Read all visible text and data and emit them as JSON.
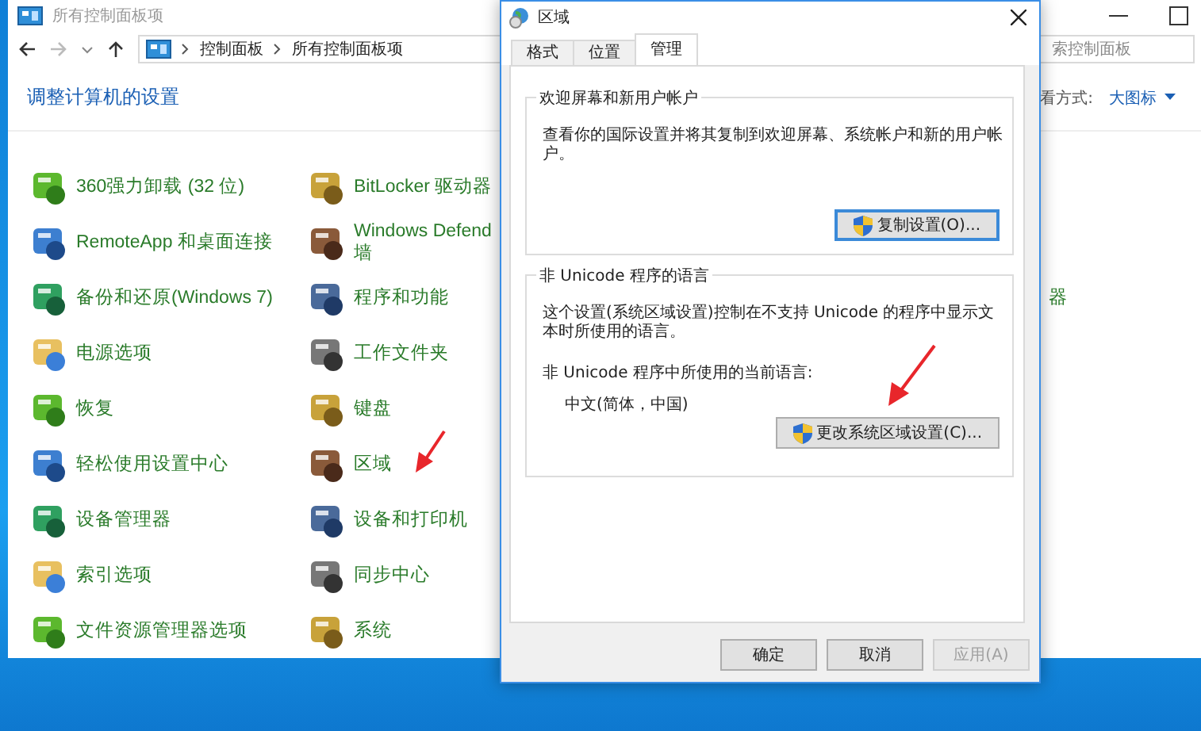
{
  "control_panel": {
    "title": "所有控制面板项",
    "breadcrumb": [
      "控制面板",
      "所有控制面板项"
    ],
    "search": {
      "placeholder": "索控制面板"
    },
    "heading": "调整计算机的设置",
    "view_label": "看方式:",
    "view_value": "大图标",
    "rows": [
      [
        {
          "label": "360强力卸载 (32 位)"
        },
        {
          "label": "BitLocker 驱动器"
        }
      ],
      [
        {
          "label": "RemoteApp 和桌面连接"
        },
        {
          "label": "Windows Defend",
          "label_2": "墙"
        }
      ],
      [
        {
          "label": "备份和还原(Windows 7)"
        },
        {
          "label": "程序和功能"
        },
        {
          "label": "器"
        }
      ],
      [
        {
          "label": "电源选项"
        },
        {
          "label": "工作文件夹"
        }
      ],
      [
        {
          "label": "恢复"
        },
        {
          "label": "键盘"
        }
      ],
      [
        {
          "label": "轻松使用设置中心"
        },
        {
          "label": "区域"
        }
      ],
      [
        {
          "label": "设备管理器"
        },
        {
          "label": "设备和打印机"
        }
      ],
      [
        {
          "label": "索引选项"
        },
        {
          "label": "同步中心"
        }
      ],
      [
        {
          "label": "文件资源管理器选项"
        },
        {
          "label": "系统"
        }
      ]
    ]
  },
  "dialog": {
    "title": "区域",
    "tabs": [
      {
        "label": "格式",
        "selected": false
      },
      {
        "label": "位置",
        "selected": false
      },
      {
        "label": "管理",
        "selected": true
      }
    ],
    "groups": [
      {
        "legend": "欢迎屏幕和新用户帐户",
        "description": "查看你的国际设置并将其复制到欢迎屏幕、系统帐户和新的用户帐户。",
        "button": "复制设置(O)..."
      },
      {
        "legend": "非 Unicode 程序的语言",
        "description": "这个设置(系统区域设置)控制在不支持 Unicode 的程序中显示文本时所使用的语言。",
        "current_label": "非 Unicode 程序中所使用的当前语言:",
        "current_value": "中文(简体，中国)",
        "button": "更改系统区域设置(C)..."
      }
    ],
    "buttons": [
      {
        "label": "确定",
        "disabled": false
      },
      {
        "label": "取消",
        "disabled": false
      },
      {
        "label": "应用(A)",
        "disabled": true
      }
    ]
  }
}
